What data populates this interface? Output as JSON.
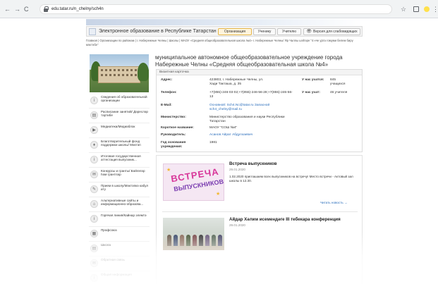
{
  "browser": {
    "back_icon": "←",
    "forward_icon": "→",
    "reload_icon": "C",
    "url": "edu.tatar.ru/n_chelny/sch4n",
    "star_icon": "☆",
    "menu_icon": "⋮"
  },
  "header": {
    "site_title": "Электронное образование в Республике Татарстан",
    "buttons": {
      "org": "Организация",
      "student": "Ученику",
      "teacher": "Учителю",
      "vision": "Версия для слабовидящих"
    },
    "eye_icon": "👁"
  },
  "breadcrumb": "Главная  |  Организации по районам  |  г. Набережные Челны  |  Школы  |  МАОУ «Средняя общеобразовательная школа №4» г. Набережные Челны/ Яр Чаллы шәһәре \"4 нче урта гомуми белем бирү мәктәбе\"",
  "org_title": "муниципальное автономное общеобразовательное учреждение города Набережные Челны «Средняя общеобразовательная школа №4»",
  "card": {
    "heading": "Визитная карточка",
    "address_label": "Адрес:",
    "address_value": "423803, г. Набережные Челны, ул. Хади Такташа, д. 35",
    "phone_label": "Телефон:",
    "phone_value": "+7(855)-246-03-02;+7(855)-246-56-28;+7(855)-246-56-13",
    "email_label": "E-Mail:",
    "email_value": "Основной: Sch4.Nc@tatar.ru Запасной sch4_chelny@mail.ru",
    "ministry_label": "Министерство:",
    "ministry_value": "Министерство образования и науки Республики Татарстан",
    "short_label": "Короткое название:",
    "short_value": "МАОУ \"СОШ №4\"",
    "head_label": "Руководитель:",
    "head_value": "Асанов Айрат Абдулхаевич",
    "year_label": "Год основания учреждения:",
    "year_value": "1981",
    "students_label": "У нас учатся:",
    "students_value": "845 учащихся",
    "teachers_label": "У нас учат:",
    "teachers_value": "46 учителя"
  },
  "menu": [
    {
      "icon": "i",
      "label": "Сведения об образовательной организации"
    },
    {
      "icon": "▤",
      "label": "Расписание занятий/ Дәресләр тәртибе"
    },
    {
      "icon": "▶",
      "label": "Медиатека/Медиаблок"
    },
    {
      "icon": "♦",
      "label": "Благотворительный фонд поддержки школы/ Мәктәп"
    },
    {
      "icon": "i",
      "label": "Итоговая государственная аттестация выпускник..."
    },
    {
      "icon": "✉",
      "label": "Конкурсы и гранты/ Бәйгеләр һәм грантлар"
    },
    {
      "icon": "✎",
      "label": "Прием в школу/Мәктәпкә кабул итү"
    },
    {
      "icon": "⌂",
      "label": "Альтернативные сайты и информационно-образова..."
    },
    {
      "icon": "i",
      "label": "Горячая линия/Кайнар элемтә"
    },
    {
      "icon": "▦",
      "label": "Профсоюз"
    },
    {
      "icon": "▤",
      "label": "Школа"
    },
    {
      "icon": "✉",
      "label": "Обратная связь"
    },
    {
      "icon": "i",
      "label": "Общая информация"
    }
  ],
  "news": [
    {
      "title": "Встреча выпускников",
      "date": "29.01.2020",
      "text": "1.02.2020 приглашаем всех выпускников на встречу! Место встречи - Актовый зал школы в 12.30.",
      "more": "Читать новость  →",
      "image_text": "ВСТРЕЧА",
      "image_text2": "ВЫПУСКНИКОВ"
    },
    {
      "title": "Айдар Хәлим исемендәге III тебекара конференция",
      "date": "29.01.2020"
    }
  ]
}
